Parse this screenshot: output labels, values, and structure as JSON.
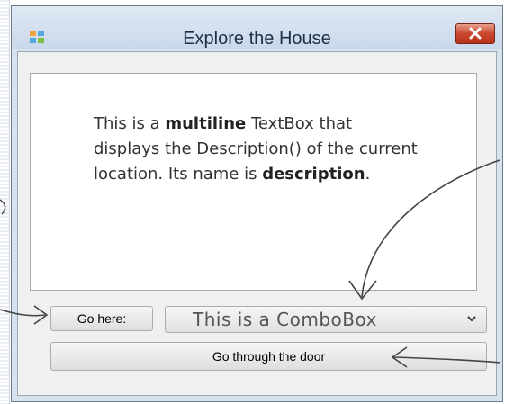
{
  "window": {
    "title": "Explore the House",
    "icon": "window-app-icon",
    "close_icon": "close-icon"
  },
  "description": {
    "name": "description",
    "text_1": "This is a ",
    "text_bold_1": "multiline",
    "text_2": " TextBox that displays the Description() of the current location. Its name is ",
    "text_bold_2": "description",
    "text_3": "."
  },
  "controls": {
    "go_here_label": "Go here:",
    "combo_text": "This is a ComboBox",
    "door_label": "Go through the door"
  },
  "colors": {
    "titlebar": "#c9d8ea",
    "close_button": "#c9452e",
    "client_background": "#f0f0f0",
    "annotation_ink": "#444444"
  }
}
